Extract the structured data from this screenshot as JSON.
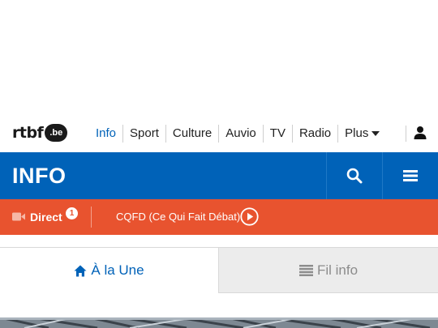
{
  "brand": {
    "logo_text": "rtbf",
    "logo_suffix": ".be"
  },
  "nav": {
    "items": [
      {
        "label": "Info",
        "active": true
      },
      {
        "label": "Sport",
        "active": false
      },
      {
        "label": "Culture",
        "active": false
      },
      {
        "label": "Auvio",
        "active": false
      },
      {
        "label": "TV",
        "active": false
      },
      {
        "label": "Radio",
        "active": false
      },
      {
        "label": "Plus",
        "active": false
      }
    ],
    "user_icon": "user-icon"
  },
  "header": {
    "title": "INFO",
    "search_icon": "search-icon",
    "menu_icon": "hamburger-menu-icon",
    "color": "#0062b8"
  },
  "live": {
    "direct_label": "Direct",
    "direct_count": "1",
    "program_label": "CQFD (Ce Qui Fait Débat)",
    "color": "#e8532f"
  },
  "tabs": {
    "une_label": "À la Une",
    "fil_label": "Fil info",
    "active": "une"
  }
}
